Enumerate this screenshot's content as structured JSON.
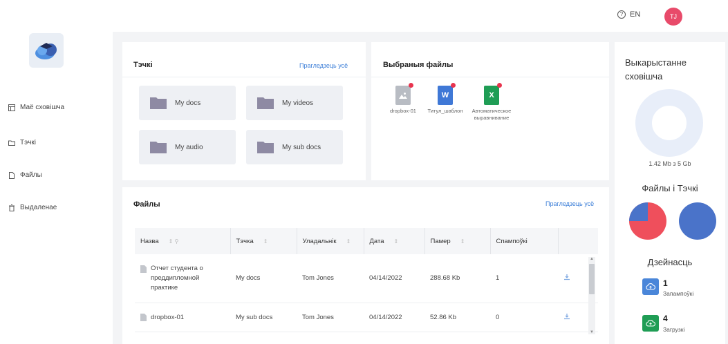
{
  "header": {
    "language": "EN",
    "avatar_initials": "TJ"
  },
  "sidebar": {
    "items": [
      {
        "label": "Маё сховішча",
        "icon": "storage-icon"
      },
      {
        "label": "Тэчкі",
        "icon": "folder-icon"
      },
      {
        "label": "Файлы",
        "icon": "file-icon"
      },
      {
        "label": "Выдаленае",
        "icon": "trash-icon"
      }
    ]
  },
  "folders_card": {
    "title": "Тэчкі",
    "view_all": "Прагледзець усё",
    "folders": [
      "My docs",
      "My videos",
      "My audio",
      "My sub docs"
    ]
  },
  "favorites_card": {
    "title": "Выбраныя файлы",
    "files": [
      {
        "name": "dropbox-01",
        "type": "image",
        "color": "#b8bcc3"
      },
      {
        "name": "Титул_шаблон",
        "type": "word",
        "letter": "W",
        "color": "#3f78d6"
      },
      {
        "name": "Автоматическое выравнивание",
        "type": "excel",
        "letter": "X",
        "color": "#1f9d55"
      }
    ]
  },
  "files_card": {
    "title": "Файлы",
    "view_all": "Прагледзець усё",
    "columns": [
      "Назва",
      "Тэчка",
      "Уладальнік",
      "Дата",
      "Памер",
      "Спампоўкі"
    ],
    "rows": [
      {
        "name": "Отчет студента о преддипломной практике",
        "folder": "My docs",
        "owner": "Tom Jones",
        "date": "04/14/2022",
        "size": "288.68 Kb",
        "downloads": "1"
      },
      {
        "name": "dropbox-01",
        "folder": "My sub docs",
        "owner": "Tom Jones",
        "date": "04/14/2022",
        "size": "52.86 Kb",
        "downloads": "0"
      }
    ]
  },
  "storage": {
    "title": "Выкарыстанне сховішча",
    "usage_text": "1.42 Mb з 5 Gb",
    "ring_color": "#e8eef9"
  },
  "files_folders": {
    "title": "Файлы і Тэчкі",
    "pie1": {
      "blue_fraction": 0.25,
      "blue": "#4a73c9",
      "red": "#ef4f5c"
    },
    "pie2": {
      "color": "#4a73c9"
    }
  },
  "activity": {
    "title": "Дзейнасць",
    "items": [
      {
        "count": "1",
        "label": "Запампоўкі",
        "color": "#4a86d9",
        "icon": "cloud-upload-icon"
      },
      {
        "count": "4",
        "label": "Загрузкі",
        "color": "#1f9d55",
        "icon": "cloud-download-icon"
      }
    ]
  }
}
